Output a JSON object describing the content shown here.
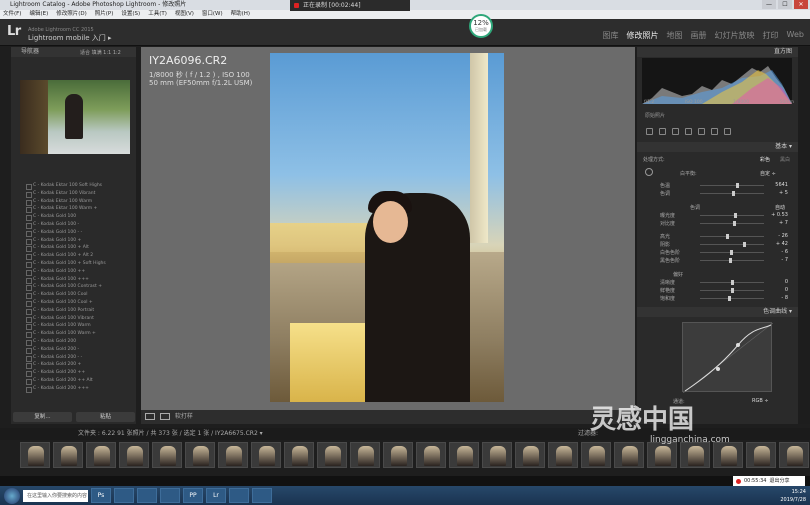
{
  "window": {
    "title": "Lightroom Catalog - Adobe Photoshop Lightroom - 修改照片",
    "controls": [
      "—",
      "☐",
      "✕"
    ]
  },
  "menubar": [
    "文件(F)",
    "编辑(E)",
    "修改照片(D)",
    "照片(P)",
    "设置(S)",
    "工具(T)",
    "视图(V)",
    "窗口(W)",
    "帮助(H)"
  ],
  "recorder": {
    "status": "正在录制 [00:02:44]"
  },
  "header": {
    "logo": "Lr",
    "identity_small": "Adobe Lightroom CC 2015",
    "identity": "Lightroom mobile 入门 ▸",
    "modules": [
      "图库",
      "修改照片",
      "地图",
      "画册",
      "幻灯片放映",
      "打印",
      "Web"
    ],
    "active_module": "修改照片",
    "progress": "12",
    "progress_unit": "%",
    "progress_note": "已加载"
  },
  "left_panel": {
    "navigator": "导航器",
    "nav_zoom": "适合  填满  1:1  1:2",
    "presets": [
      "C - Kodak Ektar 100 Soft Highs",
      "C - Kodak Ektar 100 Vibrant",
      "C - Kodak Ektar 100 Warm",
      "C - Kodak Ektar 100 Warm +",
      "C - Kodak Gold 100",
      "C - Kodak Gold 100 -",
      "C - Kodak Gold 100 - -",
      "C - Kodak Gold 100 +",
      "C - Kodak Gold 100 + Alt",
      "C - Kodak Gold 100 + Alt 2",
      "C - Kodak Gold 100 + Soft Highs",
      "C - Kodak Gold 100 ++",
      "C - Kodak Gold 100 +++",
      "C - Kodak Gold 100 Contrast +",
      "C - Kodak Gold 100 Cool",
      "C - Kodak Gold 100 Cool +",
      "C - Kodak Gold 100 Portrait",
      "C - Kodak Gold 100 Vibrant",
      "C - Kodak Gold 100 Warm",
      "C - Kodak Gold 100 Warm +",
      "C - Kodak Gold 200",
      "C - Kodak Gold 200 -",
      "C - Kodak Gold 200 - -",
      "C - Kodak Gold 200 +",
      "C - Kodak Gold 200 ++",
      "C - Kodak Gold 200 ++ Alt",
      "C - Kodak Gold 200 +++"
    ],
    "copy_button": "复制...",
    "paste_button": "粘贴"
  },
  "photo_info": {
    "filename": "IY2A6096.CR2",
    "exposure": "1/8000 秒 ( f / 1.2 ) , ISO 100",
    "lens": "50 mm (EF50mm f/1.2L USM)"
  },
  "center_toolbar": {
    "softproof": "软打样"
  },
  "right_panel": {
    "histogram": "直方图",
    "hist_info": [
      "f/1.2",
      "ISO 100",
      "1/8000",
      "50mm"
    ],
    "original": "原始照片",
    "basic": "基本 ▾",
    "treatment": "处理方式:",
    "color": "彩色",
    "bw": "黑白",
    "wb_label": "白平衡:",
    "wb_value": "自定 ÷",
    "sliders_wb": [
      {
        "label": "色温",
        "value": "5641",
        "pos": 0.58
      },
      {
        "label": "色调",
        "value": "+ 5",
        "pos": 0.52
      }
    ],
    "tone_label": "色调",
    "tone_auto": "自动",
    "sliders_tone": [
      {
        "label": "曝光度",
        "value": "+ 0.53",
        "pos": 0.55
      },
      {
        "label": "对比度",
        "value": "+ 7",
        "pos": 0.53
      }
    ],
    "sliders_tone2": [
      {
        "label": "高光",
        "value": "- 26",
        "pos": 0.42
      },
      {
        "label": "阴影",
        "value": "+ 42",
        "pos": 0.68
      },
      {
        "label": "白色色阶",
        "value": "- 6",
        "pos": 0.48
      },
      {
        "label": "黑色色阶",
        "value": "- 7",
        "pos": 0.47
      }
    ],
    "presence_label": "偏好",
    "sliders_presence": [
      {
        "label": "清晰度",
        "value": "0",
        "pos": 0.5
      },
      {
        "label": "鲜艳度",
        "value": "0",
        "pos": 0.5
      },
      {
        "label": "饱和度",
        "value": "- 8",
        "pos": 0.45
      }
    ],
    "tone_curve": "色调曲线 ▾",
    "channel_label": "通道:",
    "channel_value": "RGB ÷"
  },
  "filmstrip": {
    "info": "文件夹 : 6.22   91 张照片 / 共 373 张 / 选定 1 张 / IY2A6675.CR2 ▾",
    "filter": "过滤器:",
    "count": 24
  },
  "watermark": {
    "main": "灵感中国",
    "sub": "lingganchina.com"
  },
  "taskbar": {
    "search": "在这里输入你要搜索的内容",
    "apps": [
      "Ps",
      "",
      "",
      "",
      "PP",
      "Lr",
      "",
      ""
    ]
  },
  "tray": {
    "time": "15:24",
    "date": "2019/7/28"
  },
  "recstat": {
    "time": "00:55:34",
    "stop": "退出分享"
  }
}
